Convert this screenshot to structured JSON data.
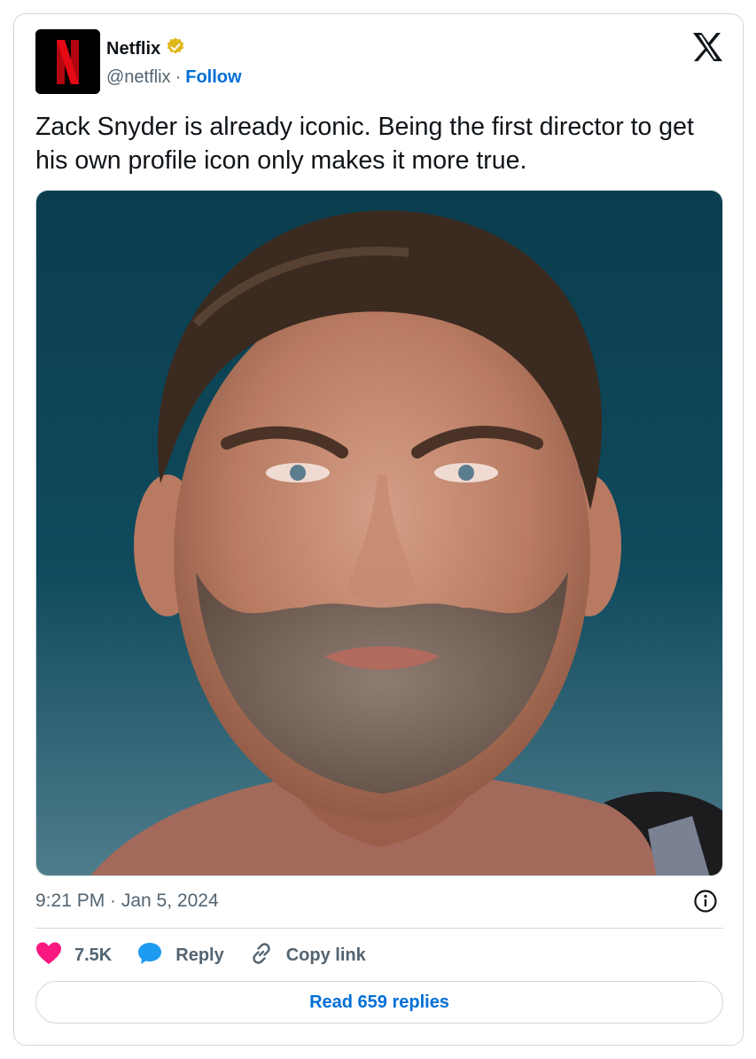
{
  "account": {
    "name": "Netflix",
    "handle": "@netflix",
    "separator": "·",
    "follow_label": "Follow",
    "verified": true,
    "avatar_letter": "N",
    "colors": {
      "brand_red": "#e50914",
      "follow_blue": "#006fd6",
      "verified_gold": "#e2b719"
    }
  },
  "tweet": {
    "text": "Zack Snyder is already iconic. Being the first director to get his own profile icon only makes it more true.",
    "timestamp": "9:21 PM · Jan 5, 2024"
  },
  "actions": {
    "likes": "7.5K",
    "reply_label": "Reply",
    "copy_link_label": "Copy link",
    "like_color": "#f91880",
    "reply_icon_color": "#1d9bf0"
  },
  "footer": {
    "read_replies_label": "Read 659 replies"
  },
  "icons": [
    "x-logo-icon",
    "verified-badge-icon",
    "heart-icon",
    "speech-bubble-icon",
    "link-icon",
    "info-icon"
  ]
}
